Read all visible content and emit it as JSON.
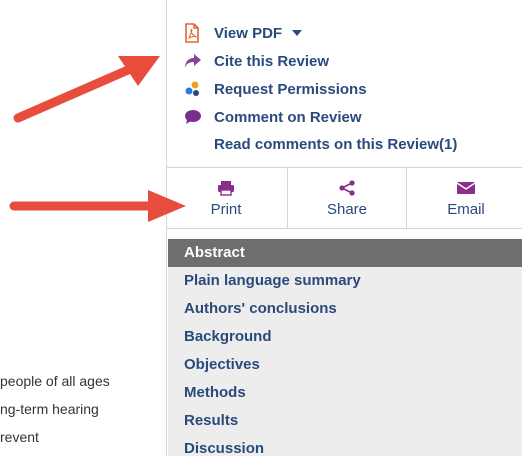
{
  "actions": {
    "view_pdf": "View PDF",
    "cite": "Cite this Review",
    "permissions": "Request Permissions",
    "comment": "Comment on Review",
    "read_comments": "Read comments on this Review(1)"
  },
  "tools": {
    "print": "Print",
    "share": "Share",
    "email": "Email"
  },
  "toc": {
    "items": [
      "Abstract",
      "Plain language summary",
      "Authors' conclusions",
      "Background",
      "Objectives",
      "Methods",
      "Results",
      "Discussion"
    ],
    "active_index": 0
  },
  "background_text": [
    "people of all ages",
    "ng-term hearing",
    "revent"
  ],
  "colors": {
    "link": "#2a4a7c",
    "pdf_icon": "#e8602c",
    "cite_icon": "#8b3fa0",
    "comment_icon": "#7b2d8e",
    "tool_icon": "#8b2e8b",
    "annotation_arrow": "#e74c3c",
    "toc_background": "#ededed",
    "toc_active": "#6e6e6e"
  }
}
